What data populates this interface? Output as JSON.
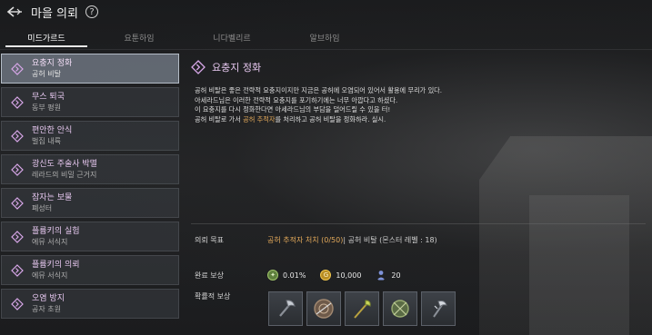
{
  "header": {
    "title": "마을 의뢰",
    "help_glyph": "?"
  },
  "tabs": [
    {
      "label": "미드가르드",
      "active": true
    },
    {
      "label": "요툰하임",
      "active": false
    },
    {
      "label": "니다벨리르",
      "active": false
    },
    {
      "label": "알브하임",
      "active": false
    }
  ],
  "quests": [
    {
      "title": "요충지 정화",
      "subtitle": "공허 비탈",
      "selected": true
    },
    {
      "title": "무스 퇴국",
      "subtitle": "동부 평원",
      "selected": false
    },
    {
      "title": "편안한 안식",
      "subtitle": "벌집 내륙",
      "selected": false
    },
    {
      "title": "광신도 주술사 박멸",
      "subtitle": "레라드의 비밀 근거지",
      "selected": false
    },
    {
      "title": "잠자는 보물",
      "subtitle": "폐성터",
      "selected": false
    },
    {
      "title": "플륨키의 실험",
      "subtitle": "에뮤 서식지",
      "selected": false
    },
    {
      "title": "플륨키의 의뢰",
      "subtitle": "에뮤 서식지",
      "selected": false
    },
    {
      "title": "오염 방지",
      "subtitle": "공자 초원",
      "selected": false
    }
  ],
  "detail": {
    "title": "요충지 정화",
    "description": [
      "공허 비탈은 좋은 전략적 요충지이지만 지금은 공허에 오염되어 있어서 활용에 무리가 있다.",
      "아세라드님은 이러한 전략적 요충지를 포기하기에는 너무 아깝다고 하셨다.",
      "이 요충지를 다시 정화한다면 아세라드님의 부담을 덜어드릴 수 있을 터!"
    ],
    "last_line_prefix": "공허 비탈로 가서 ",
    "last_line_highlight": "공허 추적자",
    "last_line_suffix": "를 처리하고 공허 비탈을 정화하라. 실시.",
    "objective_label": "의뢰 목표",
    "objective_highlight": "공허 추적자 처치 (0/50)",
    "objective_rest": " | 공허 비탈 (몬스터 레벨 : 18)",
    "completion_reward_label": "완료 보상",
    "rewards": {
      "exp": "0.01%",
      "gold": "10,000",
      "reputation": "20"
    },
    "probable_reward_label": "확률적 보상",
    "probable_rewards": [
      "axe-icon",
      "shield-icon",
      "staff-icon",
      "orb-icon",
      "hatchet-icon"
    ]
  },
  "colors": {
    "accent_purple": "#e6c7ef",
    "highlight_orange": "#e3a95a"
  }
}
